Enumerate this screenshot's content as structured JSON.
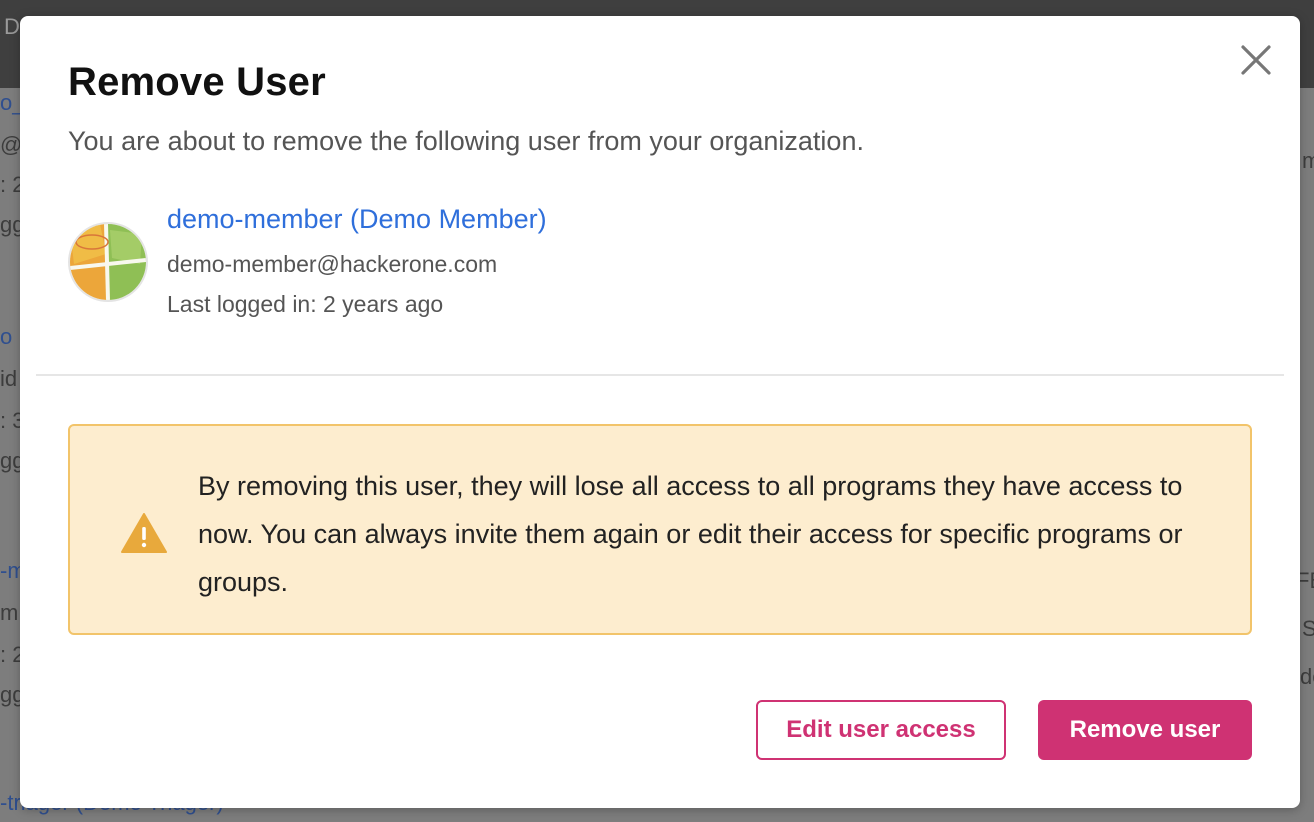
{
  "background": {
    "topbar_text": "D",
    "left_fragments": [
      "o_",
      "@",
      ": 2",
      "gg",
      "o",
      "id",
      ": 3",
      "gg",
      "-m",
      "m",
      ": 2",
      "gg"
    ],
    "right_fragments": [
      "m",
      "FB",
      "S",
      "de"
    ],
    "bottom_text": "-triager (Demo Triager)"
  },
  "modal": {
    "title": "Remove User",
    "subtitle": "You are about to remove the following user from your organization.",
    "close_icon": "close-icon",
    "user": {
      "display_name": "demo-member (Demo Member)",
      "email": "demo-member@hackerone.com",
      "last_logged_in": "Last logged in: 2 years ago",
      "avatar_icon": "avatar"
    },
    "warning": {
      "icon": "warning-icon",
      "text": "By removing this user, they will lose all access to all programs they have access to now. You can always invite them again or edit their access for specific programs or groups."
    },
    "actions": {
      "edit_label": "Edit user access",
      "remove_label": "Remove user"
    }
  },
  "colors": {
    "accent": "#cf3273",
    "link": "#2f6fdb",
    "warning_bg": "#fdedcf",
    "warning_border": "#f2c46a",
    "warning_icon": "#e8a93c"
  }
}
